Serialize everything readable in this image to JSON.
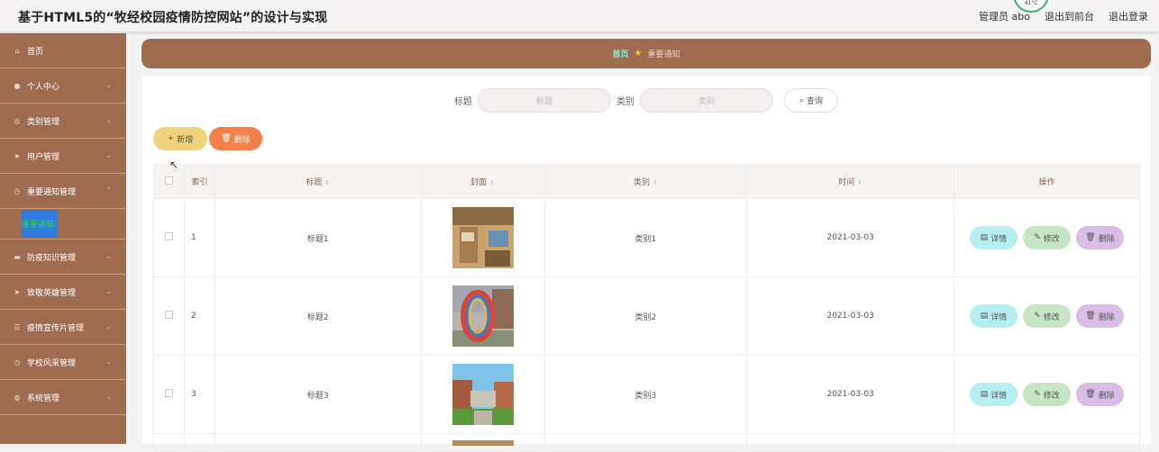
{
  "header": {
    "title": "基于HTML5的“牧经校园疫情防控网站”的设计与实现",
    "user": "管理员 abo",
    "front": "退出到前台",
    "logout": "退出登录",
    "weather": "41°C"
  },
  "sidebar": {
    "items": [
      {
        "label": "首页",
        "icon": "home-icon"
      },
      {
        "label": "个人中心",
        "icon": "user-icon"
      },
      {
        "label": "类别管理",
        "icon": "category-icon"
      },
      {
        "label": "用户管理",
        "icon": "send-icon"
      },
      {
        "label": "重要通知管理",
        "icon": "clock-icon"
      }
    ],
    "sub_item": "重要通知",
    "items_after": [
      {
        "label": "防疫知识管理",
        "icon": "chat-icon"
      },
      {
        "label": "致敬英雄管理",
        "icon": "send-icon"
      },
      {
        "label": "疫情宣传片管理",
        "icon": "sliders-icon"
      },
      {
        "label": "学校风采管理",
        "icon": "clock-icon"
      },
      {
        "label": "系统管理",
        "icon": "globe-icon"
      }
    ]
  },
  "breadcrumb": {
    "home": "首页",
    "current": "重要通知"
  },
  "search": {
    "title_label": "标题",
    "title_placeholder": "标题",
    "category_label": "类别",
    "category_placeholder": "类别",
    "query": "查询"
  },
  "actions": {
    "add": "新增",
    "delete": "删除"
  },
  "table": {
    "headers": {
      "index": "索引",
      "title": "标题",
      "cover": "封面",
      "category": "类别",
      "time": "时间",
      "ops": "操作"
    },
    "rows": [
      {
        "index": "1",
        "title": "标题1",
        "category": "类别1",
        "time": "2021-03-03"
      },
      {
        "index": "2",
        "title": "标题2",
        "category": "类别2",
        "time": "2021-03-03"
      },
      {
        "index": "3",
        "title": "标题3",
        "category": "类别3",
        "time": "2021-03-03"
      }
    ],
    "op_labels": {
      "detail": "详情",
      "edit": "修改",
      "delete": "删除"
    }
  }
}
